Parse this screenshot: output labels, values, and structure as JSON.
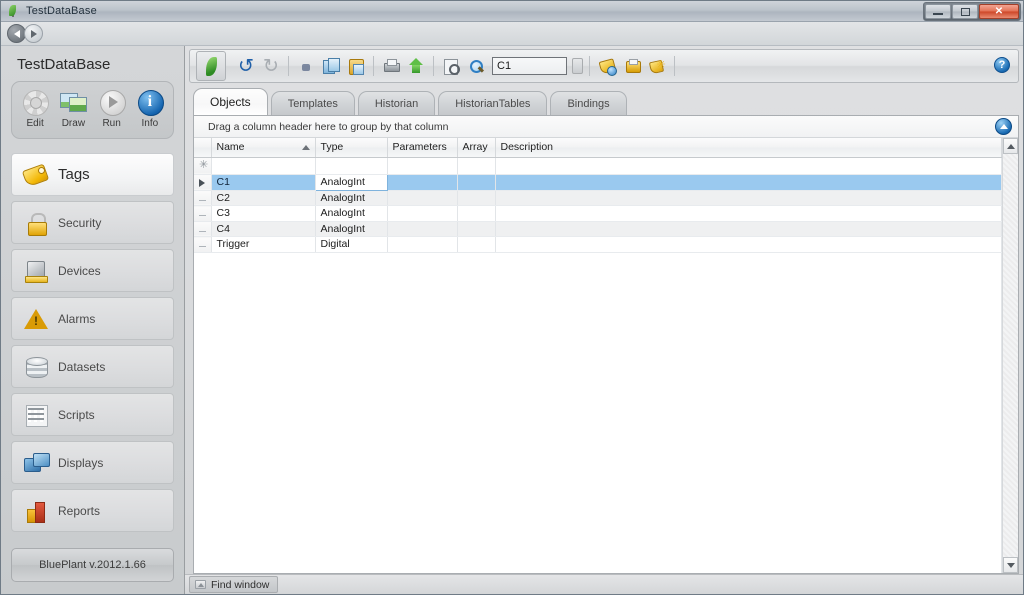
{
  "window": {
    "title": "TestDataBase",
    "app_icon": "leaf-icon",
    "buttons": {
      "minimize": "minimize-icon",
      "maximize": "maximize-icon",
      "close": "✕"
    }
  },
  "navbar": {
    "back": "back-arrow-icon",
    "forward": "forward-arrow-icon"
  },
  "sidebar": {
    "project_title": "TestDataBase",
    "modes": [
      {
        "label": "Edit",
        "icon": "gear-icon"
      },
      {
        "label": "Draw",
        "icon": "pictures-icon"
      },
      {
        "label": "Run",
        "icon": "play-icon"
      },
      {
        "label": "Info",
        "icon": "info-icon"
      }
    ],
    "items": [
      {
        "label": "Tags",
        "icon": "tag-icon",
        "active": true
      },
      {
        "label": "Security",
        "icon": "lock-icon",
        "active": false
      },
      {
        "label": "Devices",
        "icon": "device-icon",
        "active": false
      },
      {
        "label": "Alarms",
        "icon": "warning-triangle-icon",
        "active": false
      },
      {
        "label": "Datasets",
        "icon": "database-icon",
        "active": false
      },
      {
        "label": "Scripts",
        "icon": "script-grid-icon",
        "active": false
      },
      {
        "label": "Displays",
        "icon": "monitors-icon",
        "active": false
      },
      {
        "label": "Reports",
        "icon": "bar-chart-icon",
        "active": false
      }
    ],
    "version": "BluePlant  v.2012.1.66"
  },
  "toolbar": {
    "leaf_button": "leaf-logo-icon",
    "buttons": [
      {
        "name": "undo-button",
        "icon": "undo-icon",
        "enabled": true
      },
      {
        "name": "redo-button",
        "icon": "redo-icon",
        "enabled": false
      },
      {
        "name": "cut-button",
        "icon": "cut-icon",
        "enabled": true
      },
      {
        "name": "copy-button",
        "icon": "copy-icon",
        "enabled": true
      },
      {
        "name": "paste-button",
        "icon": "paste-icon",
        "enabled": true
      },
      {
        "name": "print-button",
        "icon": "print-icon",
        "enabled": true
      },
      {
        "name": "import-button",
        "icon": "upload-arrow-icon",
        "enabled": true
      },
      {
        "name": "print-preview-button",
        "icon": "preview-icon",
        "enabled": true
      },
      {
        "name": "search-button",
        "icon": "search-icon",
        "enabled": true
      }
    ],
    "search_value": "C1",
    "search_placeholder": "",
    "tag_buttons": [
      {
        "name": "new-tag-button",
        "icon": "tag-blue-icon"
      },
      {
        "name": "tag-properties-button",
        "icon": "tag-properties-icon"
      },
      {
        "name": "tag-wizard-button",
        "icon": "tag-wizard-icon"
      }
    ],
    "help": "?"
  },
  "tabs": [
    {
      "label": "Objects",
      "active": true
    },
    {
      "label": "Templates",
      "active": false
    },
    {
      "label": "Historian",
      "active": false
    },
    {
      "label": "HistorianTables",
      "active": false
    },
    {
      "label": "Bindings",
      "active": false
    }
  ],
  "grid": {
    "group_hint": "Drag a column header here to group by that column",
    "badge_icon": "info-home-icon",
    "columns": [
      {
        "label": "Name",
        "sorted": "asc"
      },
      {
        "label": "Type",
        "sorted": ""
      },
      {
        "label": "Parameters",
        "sorted": ""
      },
      {
        "label": "Array",
        "sorted": ""
      },
      {
        "label": "Description",
        "sorted": ""
      }
    ],
    "new_row_marker": "✳",
    "current_row_marker": "▶",
    "rows": [
      {
        "marker": "▶",
        "name": "C1",
        "type": "AnalogInt",
        "parameters": "",
        "array": "",
        "description": "",
        "selected": true
      },
      {
        "marker": "",
        "name": "C2",
        "type": "AnalogInt",
        "parameters": "",
        "array": "",
        "description": "",
        "selected": false
      },
      {
        "marker": "",
        "name": "C3",
        "type": "AnalogInt",
        "parameters": "",
        "array": "",
        "description": "",
        "selected": false
      },
      {
        "marker": "",
        "name": "C4",
        "type": "AnalogInt",
        "parameters": "",
        "array": "",
        "description": "",
        "selected": false
      },
      {
        "marker": "",
        "name": "Trigger",
        "type": "Digital",
        "parameters": "",
        "array": "",
        "description": "",
        "selected": false
      }
    ]
  },
  "statusbar": {
    "find_window": "Find window"
  },
  "colors": {
    "selection_blue": "#9ac9ef",
    "accent_blue": "#1a6cb4",
    "close_red": "#cc4526",
    "tag_yellow": "#e0a705",
    "window_chrome": "#d2d6d9"
  }
}
